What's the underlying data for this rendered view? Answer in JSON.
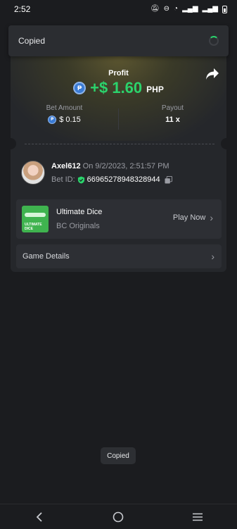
{
  "status_bar": {
    "time": "2:52"
  },
  "toast_top": {
    "label": "Copied"
  },
  "bet": {
    "profit_label": "Profit",
    "profit_value": "+$ 1.60",
    "currency": "PHP",
    "bet_amount_label": "Bet Amount",
    "bet_amount_value": "$ 0.15",
    "payout_label": "Payout",
    "payout_value": "11 x"
  },
  "player": {
    "name": "Axel612",
    "timestamp": "On 9/2/2023, 2:51:57 PM",
    "bet_id_label": "Bet ID:",
    "bet_id": "66965278948328944"
  },
  "game": {
    "title": "Ultimate Dice",
    "subtitle": "BC Originals",
    "play_label": "Play Now",
    "thumb_text": "ULTIMATE DICE"
  },
  "details": {
    "label": "Game Details"
  },
  "toast_bottom": {
    "label": "Copied"
  },
  "colors": {
    "profit_green": "#2bd36c",
    "coin_blue": "#3a7bd5",
    "bg": "#1b1c1f"
  },
  "icons": [
    "mute-icon",
    "wifi-icon",
    "signal-icon",
    "battery-icon",
    "share-icon",
    "shield-check-icon",
    "copy-icon",
    "chevron-right-icon",
    "back-icon",
    "home-icon",
    "menu-icon"
  ]
}
